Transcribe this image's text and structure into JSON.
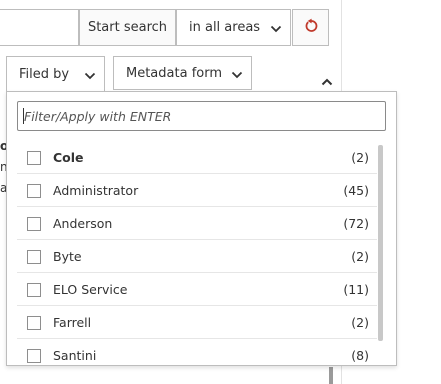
{
  "toolbar": {
    "start_search_label": "Start search",
    "areas_value": "in all areas"
  },
  "filters": {
    "filed_by_label": "Filed by",
    "metadata_form_label": "Metadata form"
  },
  "background": {
    "fragments": [
      "o",
      "n",
      "a"
    ]
  },
  "dropdown": {
    "filter_placeholder": "Filter/Apply with ENTER",
    "items": [
      {
        "name": "Cole",
        "count": "(2)",
        "bold": true
      },
      {
        "name": "Administrator",
        "count": "(45)",
        "bold": false
      },
      {
        "name": "Anderson",
        "count": "(72)",
        "bold": false
      },
      {
        "name": "Byte",
        "count": "(2)",
        "bold": false
      },
      {
        "name": "ELO Service",
        "count": "(11)",
        "bold": false
      },
      {
        "name": "Farrell",
        "count": "(2)",
        "bold": false
      },
      {
        "name": "Santini",
        "count": "(8)",
        "bold": false
      }
    ]
  },
  "colors": {
    "reset_icon": "#c0392b",
    "border": "#bdbdbd"
  },
  "icons": {
    "reset": "reset-icon",
    "chevron": "chevron-down-icon",
    "collapse": "chevron-up-icon"
  }
}
